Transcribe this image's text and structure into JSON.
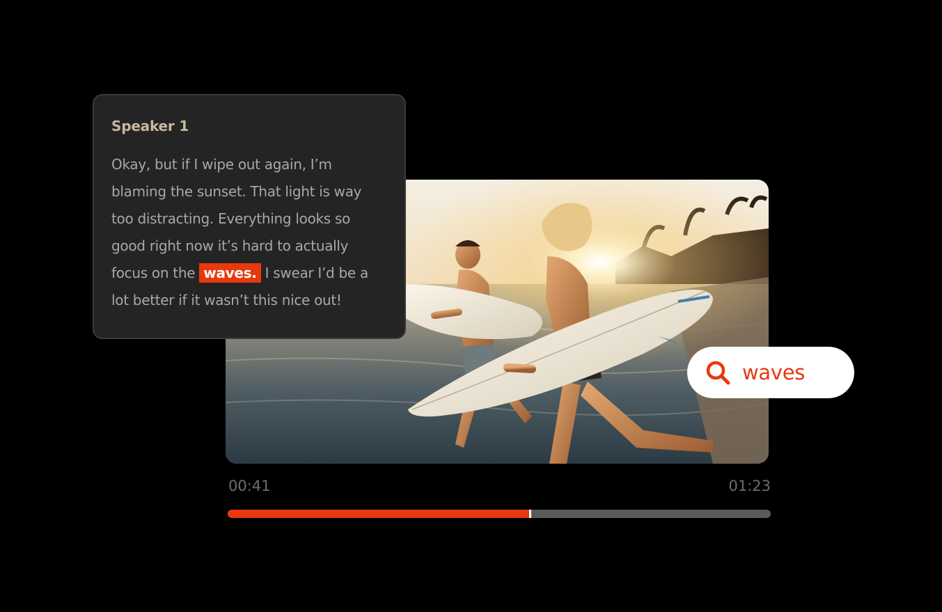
{
  "transcript": {
    "speaker": "Speaker 1",
    "before": "Okay, but if I wipe out again, I’m blaming the sunset. That light is way too distracting. Everything looks so good right now it’s hard to actually focus on the ",
    "highlight": "waves.",
    "after": " I swear I’d be a lot better if it wasn’t this nice out!"
  },
  "search": {
    "icon": "search-icon",
    "query": "waves"
  },
  "player": {
    "current_time": "00:41",
    "total_time": "01:23",
    "progress": 0.556
  },
  "colors": {
    "accent": "#e8380d",
    "card_bg": "#242424",
    "speaker": "#c9b8a0"
  }
}
